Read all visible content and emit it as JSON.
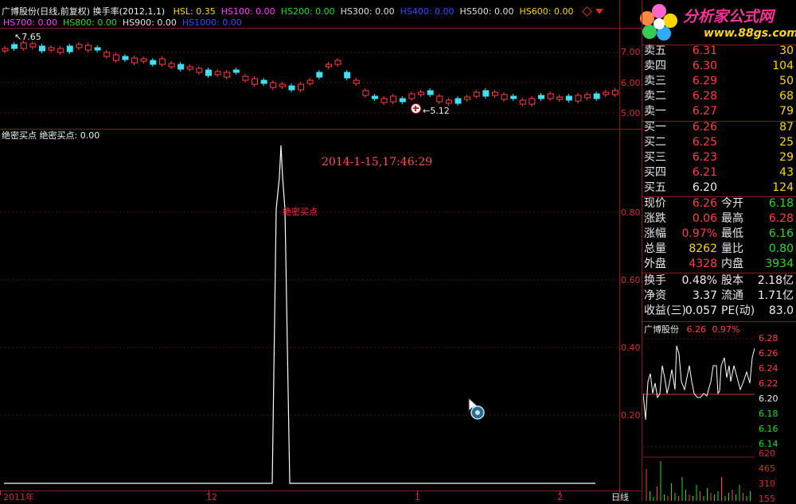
{
  "header": {
    "title": "广博股份(日线,前复权) 换手率(2012,1,1)",
    "items": [
      {
        "label": "HSL: 0.35",
        "color": "#ffd700"
      },
      {
        "label": "HS100: 0.00",
        "color": "#ff40ff"
      },
      {
        "label": "HS200: 0.00",
        "color": "#22dd22"
      },
      {
        "label": "HS300: 0.00",
        "color": "#e0e0e0"
      },
      {
        "label": "HS400: 0.00",
        "color": "#3050ff"
      },
      {
        "label": "HS500: 0.00",
        "color": "#e0e0e0"
      },
      {
        "label": "HS600: 0.00",
        "color": "#ffd700"
      },
      {
        "label": "HS700: 0.00",
        "color": "#ff40ff"
      },
      {
        "label": "HS800: 0.00",
        "color": "#22dd22"
      },
      {
        "label": "HS900: 0.00",
        "color": "#e0e0e0"
      },
      {
        "label": "HS1000: 0.00",
        "color": "#3050ff"
      }
    ]
  },
  "logo": {
    "name": "分析家公式网",
    "url": "www.88gs.com"
  },
  "price_chart": {
    "high_label": "7.65",
    "low_label": "5.12",
    "y_ticks": [
      "7.00",
      "6.00",
      "5.00"
    ]
  },
  "indicator": {
    "label": "绝密买点  绝密买点: 0.00",
    "timestamp": "2014-1-15,17:46:29",
    "annotation": "绝密买点",
    "y_ticks": [
      "0.80",
      "0.60",
      "0.40",
      "0.20"
    ]
  },
  "x_axis": {
    "labels": [
      "2011年",
      "12",
      "1",
      "2"
    ],
    "period": "日线"
  },
  "quote": {
    "asks": [
      {
        "label": "卖五",
        "price": "6.31",
        "vol": "30"
      },
      {
        "label": "卖四",
        "price": "6.30",
        "vol": "104"
      },
      {
        "label": "卖三",
        "price": "6.29",
        "vol": "50"
      },
      {
        "label": "卖二",
        "price": "6.28",
        "vol": "68"
      },
      {
        "label": "卖一",
        "price": "6.27",
        "vol": "79"
      }
    ],
    "bids": [
      {
        "label": "买一",
        "price": "6.26",
        "vol": "87"
      },
      {
        "label": "买二",
        "price": "6.25",
        "vol": "25"
      },
      {
        "label": "买三",
        "price": "6.23",
        "vol": "29"
      },
      {
        "label": "买四",
        "price": "6.21",
        "vol": "43"
      },
      {
        "label": "买五",
        "price": "6.20",
        "vol": "124"
      }
    ],
    "stats": [
      {
        "l1": "现价",
        "v1": "6.26",
        "c1": "red",
        "l2": "今开",
        "v2": "6.18",
        "c2": "grn"
      },
      {
        "l1": "涨跌",
        "v1": "0.06",
        "c1": "red",
        "l2": "最高",
        "v2": "6.28",
        "c2": "red"
      },
      {
        "l1": "涨幅",
        "v1": "0.97%",
        "c1": "red",
        "l2": "最低",
        "v2": "6.16",
        "c2": "grn"
      },
      {
        "l1": "总量",
        "v1": "8262",
        "c1": "yel",
        "l2": "量比",
        "v2": "0.80",
        "c2": "grn"
      },
      {
        "l1": "外盘",
        "v1": "4328",
        "c1": "red",
        "l2": "内盘",
        "v2": "3934",
        "c2": "grn"
      }
    ],
    "fund": [
      {
        "l1": "换手",
        "v1": "0.48%",
        "l2": "股本",
        "v2": "2.18亿"
      },
      {
        "l1": "净资",
        "v1": "3.37",
        "l2": "流通",
        "v2": "1.71亿"
      },
      {
        "l1": "收益(三)",
        "v1": "0.057",
        "l2": "PE(动)",
        "v2": "83.0"
      }
    ]
  },
  "mini": {
    "name": "广博股份",
    "price": "6.26",
    "pct": "0.97%",
    "price_ticks": [
      {
        "v": "6.28",
        "c": "#ff4040"
      },
      {
        "v": "6.26",
        "c": "#ff4040"
      },
      {
        "v": "6.24",
        "c": "#ff4040"
      },
      {
        "v": "6.22",
        "c": "#ff4040"
      },
      {
        "v": "6.20",
        "c": "#f0f0f0"
      },
      {
        "v": "6.18",
        "c": "#22dd22"
      },
      {
        "v": "6.16",
        "c": "#22dd22"
      },
      {
        "v": "6.14",
        "c": "#22dd22"
      }
    ],
    "vol_ticks": [
      "620",
      "465",
      "310",
      "155"
    ]
  }
}
